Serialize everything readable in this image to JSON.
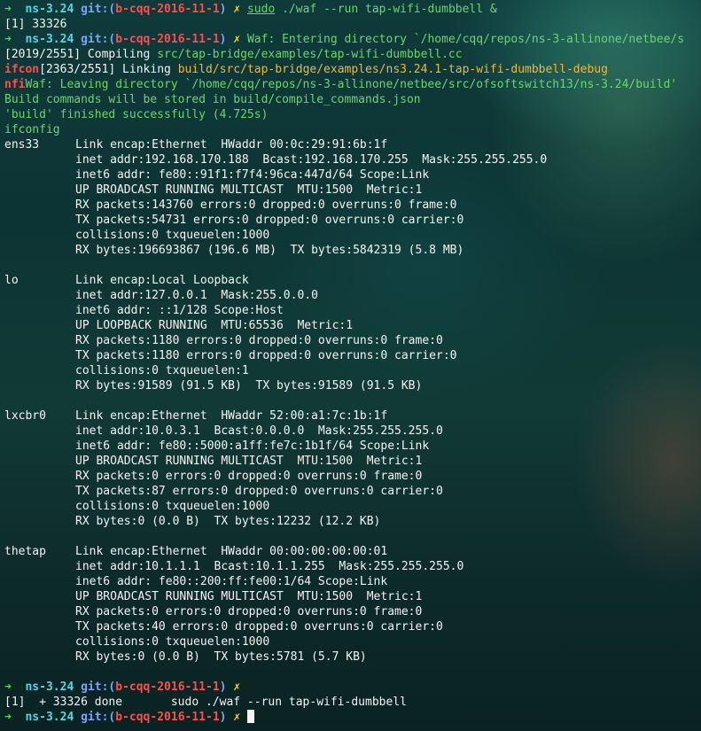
{
  "prompt": {
    "arrow": "➜",
    "dir": "ns-3.24",
    "git_label": "git:",
    "paren_open": "(",
    "branch": "b-cqq-2016-11-1",
    "paren_close": ")",
    "dirty_mark": "✗"
  },
  "lines": {
    "l1_cmd_sudo": "sudo",
    "l1_cmd_rest": " ./waf --run tap-wifi-dumbbell &",
    "l2": "[1] 33326",
    "l3_msg": "Waf: Entering directory `/home/cqq/repos/ns-3-allinone/netbee/s",
    "l4_prefix": "[2019/2551] Compiling ",
    "l4_file": "src/tap-bridge/examples/tap-wifi-dumbbell.cc",
    "l5_tag": "ifcon",
    "l5_prefix": "[2363/2551] Linking ",
    "l5_file": "build/src/tap-bridge/examples/ns3.24.1-tap-wifi-dumbbell-debug",
    "l6_tag": "nfi",
    "l6_msg": "Waf: Leaving directory `/home/cqq/repos/ns-3-allinone/netbee/src/ofsoftswitch13/ns-3.24/build'",
    "l7": "Build commands will be stored in build/compile_commands.json",
    "l8": "'build' finished successfully (4.725s)",
    "l9": "ifconfig"
  },
  "ifconfig": [
    {
      "name": "ens33",
      "rows": [
        "Link encap:Ethernet  HWaddr 00:0c:29:91:6b:1f",
        "inet addr:192.168.170.188  Bcast:192.168.170.255  Mask:255.255.255.0",
        "inet6 addr: fe80::91f1:f7f4:96ca:447d/64 Scope:Link",
        "UP BROADCAST RUNNING MULTICAST  MTU:1500  Metric:1",
        "RX packets:143760 errors:0 dropped:0 overruns:0 frame:0",
        "TX packets:54731 errors:0 dropped:0 overruns:0 carrier:0",
        "collisions:0 txqueuelen:1000",
        "RX bytes:196693867 (196.6 MB)  TX bytes:5842319 (5.8 MB)"
      ]
    },
    {
      "name": "lo",
      "rows": [
        "Link encap:Local Loopback",
        "inet addr:127.0.0.1  Mask:255.0.0.0",
        "inet6 addr: ::1/128 Scope:Host",
        "UP LOOPBACK RUNNING  MTU:65536  Metric:1",
        "RX packets:1180 errors:0 dropped:0 overruns:0 frame:0",
        "TX packets:1180 errors:0 dropped:0 overruns:0 carrier:0",
        "collisions:0 txqueuelen:1",
        "RX bytes:91589 (91.5 KB)  TX bytes:91589 (91.5 KB)"
      ]
    },
    {
      "name": "lxcbr0",
      "rows": [
        "Link encap:Ethernet  HWaddr 52:00:a1:7c:1b:1f",
        "inet addr:10.0.3.1  Bcast:0.0.0.0  Mask:255.255.255.0",
        "inet6 addr: fe80::5000:a1ff:fe7c:1b1f/64 Scope:Link",
        "UP BROADCAST RUNNING MULTICAST  MTU:1500  Metric:1",
        "RX packets:0 errors:0 dropped:0 overruns:0 frame:0",
        "TX packets:87 errors:0 dropped:0 overruns:0 carrier:0",
        "collisions:0 txqueuelen:1000",
        "RX bytes:0 (0.0 B)  TX bytes:12232 (12.2 KB)"
      ]
    },
    {
      "name": "thetap",
      "rows": [
        "Link encap:Ethernet  HWaddr 00:00:00:00:00:01",
        "inet addr:10.1.1.1  Bcast:10.1.1.255  Mask:255.255.255.0",
        "inet6 addr: fe80::200:ff:fe00:1/64 Scope:Link",
        "UP BROADCAST RUNNING MULTICAST  MTU:1500  Metric:1",
        "RX packets:0 errors:0 dropped:0 overruns:0 frame:0",
        "TX packets:40 errors:0 dropped:0 overruns:0 carrier:0",
        "collisions:0 txqueuelen:1000",
        "RX bytes:0 (0.0 B)  TX bytes:5781 (5.7 KB)"
      ]
    }
  ],
  "job_done": "[1]  + 33326 done       sudo ./waf --run tap-wifi-dumbbell",
  "colors": {
    "arrow": "#4fe04f",
    "dir": "#56d6e6",
    "git": "#7da2ff",
    "branch": "#ff4d4d",
    "dirty": "#f4d94c",
    "cmd_green": "#6fd46f",
    "link_file": "#f1b83b"
  }
}
